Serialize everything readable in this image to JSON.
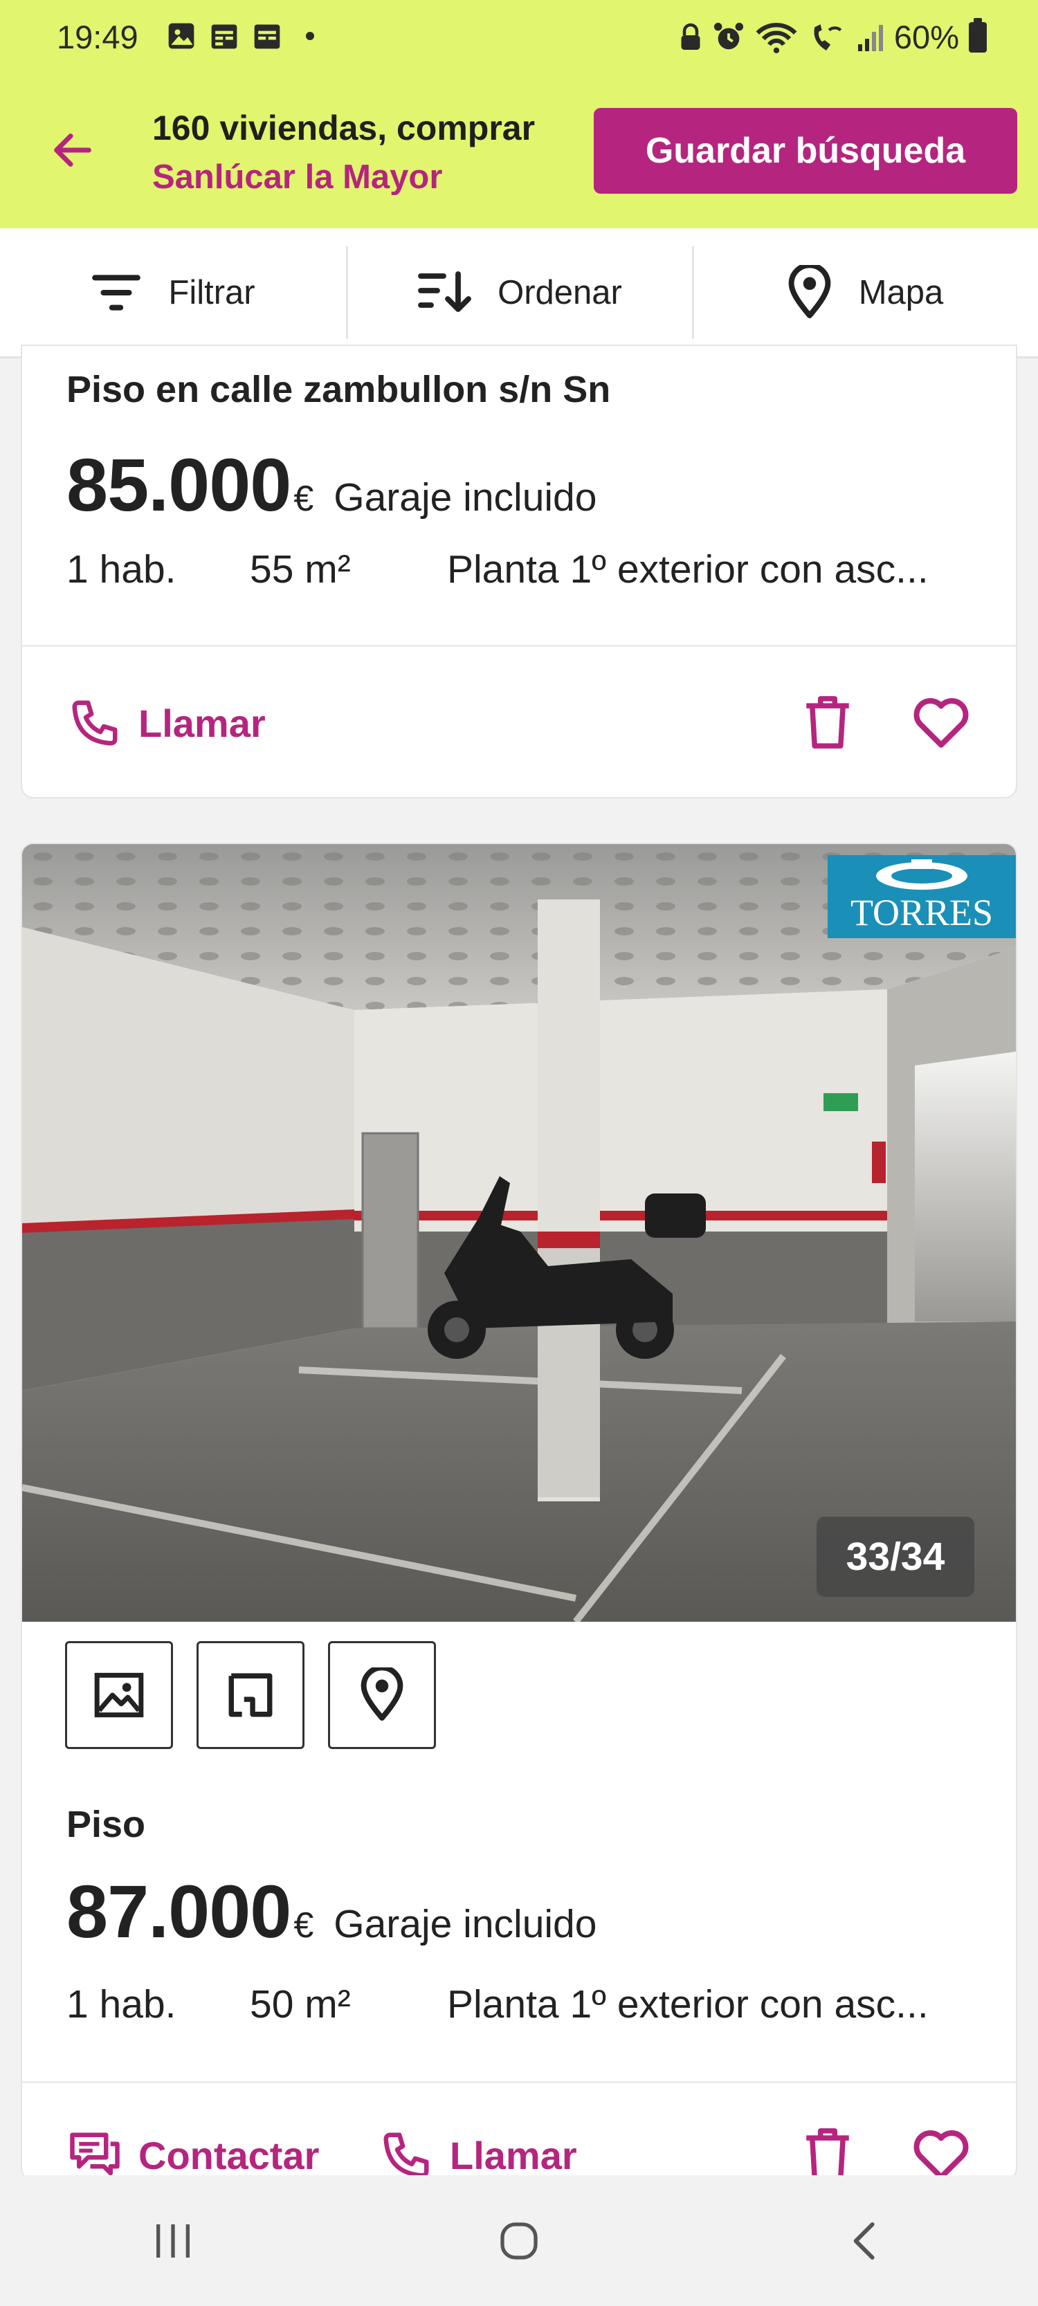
{
  "status_bar": {
    "time": "19:49",
    "battery": "60%",
    "icons": [
      "photo-icon",
      "calendar-icon",
      "calendar-icon",
      "notification-dot",
      "alarm-lock-icon",
      "alarm-icon",
      "wifi-icon",
      "wifi-calling-icon",
      "signal-icon",
      "battery-icon"
    ]
  },
  "header": {
    "title": "160 viviendas, comprar",
    "subtitle": "Sanlúcar la Mayor",
    "save_label": "Guardar búsqueda",
    "back_icon": "arrow-left-icon"
  },
  "toolbar": {
    "filter_label": "Filtrar",
    "sort_label": "Ordenar",
    "map_label": "Mapa"
  },
  "listings": [
    {
      "title": "Piso en calle zambullon s/n Sn",
      "price": "85.000",
      "currency": "€",
      "extra": "Garaje incluido",
      "rooms": "1 hab.",
      "area": "55   m²",
      "floor": "Planta 1º exterior con asc...",
      "call_label": "Llamar"
    },
    {
      "title": "Piso",
      "price": "87.000",
      "currency": "€",
      "extra": "Garaje incluido",
      "rooms": "1 hab.",
      "area": "50   m²",
      "floor": "Planta 1º exterior con asc...",
      "photo_counter": "33/34",
      "agency_logo": "TORRES",
      "contact_label": "Contactar",
      "call_label": "Llamar"
    }
  ],
  "colors": {
    "header_bg": "#e1f56e",
    "accent": "#b5257f"
  }
}
